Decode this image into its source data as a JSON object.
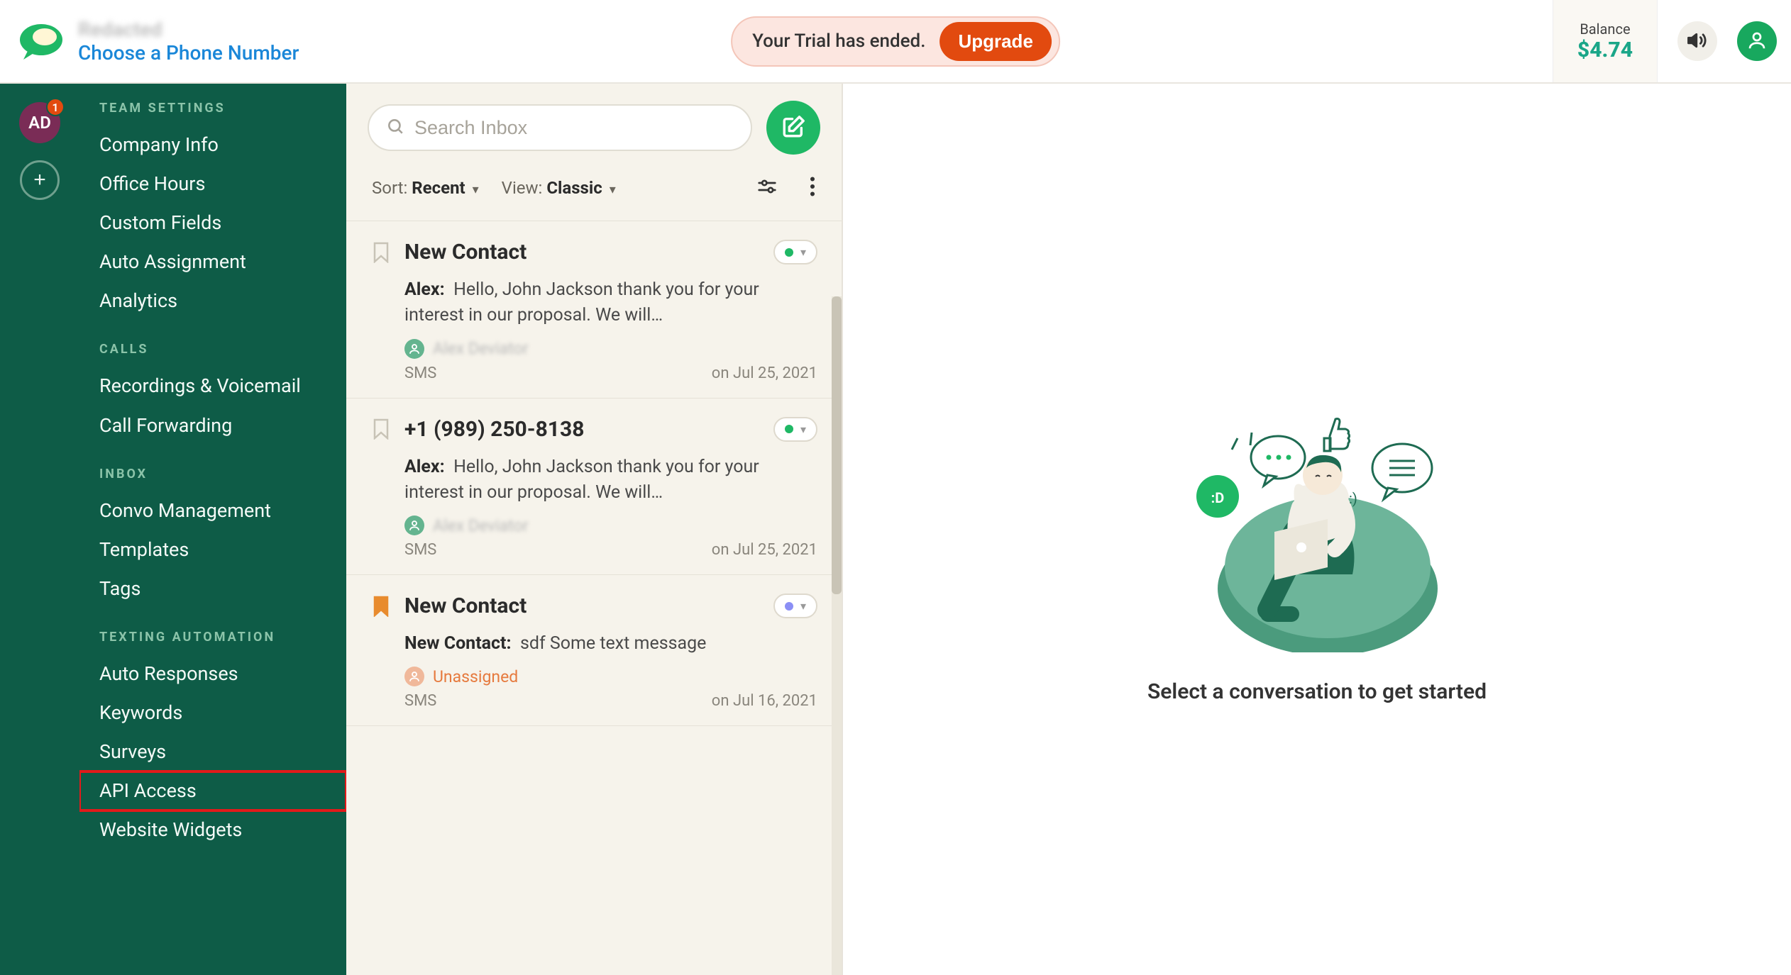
{
  "header": {
    "brand_line1": "Redacted",
    "choose_number": "Choose a Phone Number",
    "trial_text": "Your Trial has ended.",
    "upgrade_label": "Upgrade",
    "balance_label": "Balance",
    "balance_value": "$4.74"
  },
  "rail": {
    "avatar_initials": "AD",
    "avatar_badge": "1"
  },
  "sidebar": {
    "sections": [
      {
        "heading": "TEAM SETTINGS",
        "items": [
          "Company Info",
          "Office Hours",
          "Custom Fields",
          "Auto Assignment",
          "Analytics"
        ]
      },
      {
        "heading": "CALLS",
        "items": [
          "Recordings & Voicemail",
          "Call Forwarding"
        ]
      },
      {
        "heading": "INBOX",
        "items": [
          "Convo Management",
          "Templates",
          "Tags"
        ]
      },
      {
        "heading": "TEXTING AUTOMATION",
        "items": [
          "Auto Responses",
          "Keywords",
          "Surveys",
          "API Access",
          "Website Widgets"
        ]
      }
    ],
    "highlighted_item": "API Access"
  },
  "inbox": {
    "search_placeholder": "Search Inbox",
    "sort_label": "Sort:",
    "sort_value": "Recent",
    "view_label": "View:",
    "view_value": "Classic",
    "conversations": [
      {
        "title": "New Contact",
        "bookmarked": false,
        "status_color": "#1fb865",
        "author": "Alex:",
        "preview": "Hello, John Jackson thank you for your interest in our proposal. We will…",
        "assigned_blurred": true,
        "assigned_name": "Alex Deviator",
        "channel": "SMS",
        "date": "on Jul 25, 2021"
      },
      {
        "title": "+1 (989) 250-8138",
        "bookmarked": false,
        "status_color": "#1fb865",
        "author": "Alex:",
        "preview": "Hello, John Jackson thank you for your interest in our proposal. We will…",
        "assigned_blurred": true,
        "assigned_name": "Alex Deviator",
        "channel": "SMS",
        "date": "on Jul 25, 2021"
      },
      {
        "title": "New Contact",
        "bookmarked": true,
        "status_color": "#8b8ff5",
        "author": "New Contact:",
        "preview": "sdf Some text message",
        "assigned_blurred": false,
        "unassigned": true,
        "assigned_name": "Unassigned",
        "channel": "SMS",
        "date": "on Jul 16, 2021"
      }
    ]
  },
  "detail": {
    "empty_text": "Select a conversation to get started"
  }
}
